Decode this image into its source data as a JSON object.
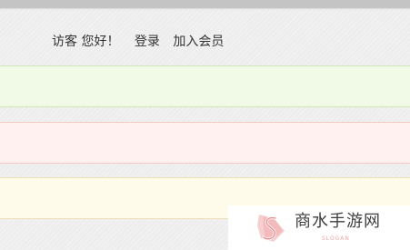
{
  "header": {
    "greeting": "访客 您好！",
    "login_label": "登录",
    "join_label": "加入会员"
  },
  "bands": [
    {
      "name": "green",
      "color": "#f1f9e7"
    },
    {
      "name": "pink",
      "color": "#fff1ef"
    },
    {
      "name": "yellow",
      "color": "#fffbeb"
    }
  ],
  "watermark": {
    "title": "商水手游网",
    "subtitle": "SLOGAN",
    "logo_icon": "s-logo-icon",
    "accent_color": "#ef8f92"
  }
}
